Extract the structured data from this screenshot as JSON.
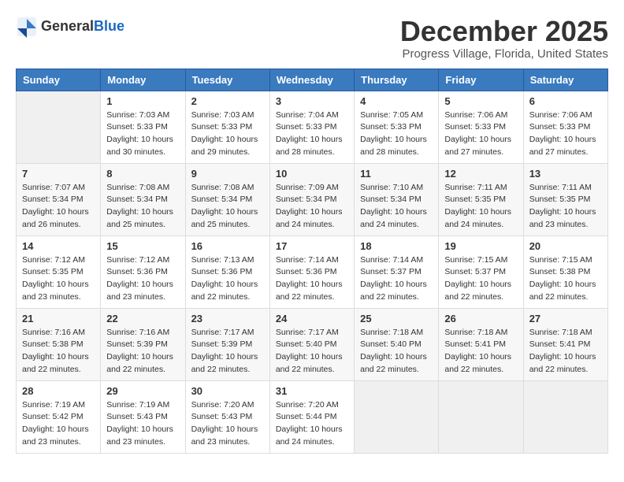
{
  "logo": {
    "general": "General",
    "blue": "Blue"
  },
  "header": {
    "month": "December 2025",
    "location": "Progress Village, Florida, United States"
  },
  "days_of_week": [
    "Sunday",
    "Monday",
    "Tuesday",
    "Wednesday",
    "Thursday",
    "Friday",
    "Saturday"
  ],
  "weeks": [
    [
      {
        "day": "",
        "info": ""
      },
      {
        "day": "1",
        "info": "Sunrise: 7:03 AM\nSunset: 5:33 PM\nDaylight: 10 hours\nand 30 minutes."
      },
      {
        "day": "2",
        "info": "Sunrise: 7:03 AM\nSunset: 5:33 PM\nDaylight: 10 hours\nand 29 minutes."
      },
      {
        "day": "3",
        "info": "Sunrise: 7:04 AM\nSunset: 5:33 PM\nDaylight: 10 hours\nand 28 minutes."
      },
      {
        "day": "4",
        "info": "Sunrise: 7:05 AM\nSunset: 5:33 PM\nDaylight: 10 hours\nand 28 minutes."
      },
      {
        "day": "5",
        "info": "Sunrise: 7:06 AM\nSunset: 5:33 PM\nDaylight: 10 hours\nand 27 minutes."
      },
      {
        "day": "6",
        "info": "Sunrise: 7:06 AM\nSunset: 5:33 PM\nDaylight: 10 hours\nand 27 minutes."
      }
    ],
    [
      {
        "day": "7",
        "info": "Sunrise: 7:07 AM\nSunset: 5:34 PM\nDaylight: 10 hours\nand 26 minutes."
      },
      {
        "day": "8",
        "info": "Sunrise: 7:08 AM\nSunset: 5:34 PM\nDaylight: 10 hours\nand 25 minutes."
      },
      {
        "day": "9",
        "info": "Sunrise: 7:08 AM\nSunset: 5:34 PM\nDaylight: 10 hours\nand 25 minutes."
      },
      {
        "day": "10",
        "info": "Sunrise: 7:09 AM\nSunset: 5:34 PM\nDaylight: 10 hours\nand 24 minutes."
      },
      {
        "day": "11",
        "info": "Sunrise: 7:10 AM\nSunset: 5:34 PM\nDaylight: 10 hours\nand 24 minutes."
      },
      {
        "day": "12",
        "info": "Sunrise: 7:11 AM\nSunset: 5:35 PM\nDaylight: 10 hours\nand 24 minutes."
      },
      {
        "day": "13",
        "info": "Sunrise: 7:11 AM\nSunset: 5:35 PM\nDaylight: 10 hours\nand 23 minutes."
      }
    ],
    [
      {
        "day": "14",
        "info": "Sunrise: 7:12 AM\nSunset: 5:35 PM\nDaylight: 10 hours\nand 23 minutes."
      },
      {
        "day": "15",
        "info": "Sunrise: 7:12 AM\nSunset: 5:36 PM\nDaylight: 10 hours\nand 23 minutes."
      },
      {
        "day": "16",
        "info": "Sunrise: 7:13 AM\nSunset: 5:36 PM\nDaylight: 10 hours\nand 22 minutes."
      },
      {
        "day": "17",
        "info": "Sunrise: 7:14 AM\nSunset: 5:36 PM\nDaylight: 10 hours\nand 22 minutes."
      },
      {
        "day": "18",
        "info": "Sunrise: 7:14 AM\nSunset: 5:37 PM\nDaylight: 10 hours\nand 22 minutes."
      },
      {
        "day": "19",
        "info": "Sunrise: 7:15 AM\nSunset: 5:37 PM\nDaylight: 10 hours\nand 22 minutes."
      },
      {
        "day": "20",
        "info": "Sunrise: 7:15 AM\nSunset: 5:38 PM\nDaylight: 10 hours\nand 22 minutes."
      }
    ],
    [
      {
        "day": "21",
        "info": "Sunrise: 7:16 AM\nSunset: 5:38 PM\nDaylight: 10 hours\nand 22 minutes."
      },
      {
        "day": "22",
        "info": "Sunrise: 7:16 AM\nSunset: 5:39 PM\nDaylight: 10 hours\nand 22 minutes."
      },
      {
        "day": "23",
        "info": "Sunrise: 7:17 AM\nSunset: 5:39 PM\nDaylight: 10 hours\nand 22 minutes."
      },
      {
        "day": "24",
        "info": "Sunrise: 7:17 AM\nSunset: 5:40 PM\nDaylight: 10 hours\nand 22 minutes."
      },
      {
        "day": "25",
        "info": "Sunrise: 7:18 AM\nSunset: 5:40 PM\nDaylight: 10 hours\nand 22 minutes."
      },
      {
        "day": "26",
        "info": "Sunrise: 7:18 AM\nSunset: 5:41 PM\nDaylight: 10 hours\nand 22 minutes."
      },
      {
        "day": "27",
        "info": "Sunrise: 7:18 AM\nSunset: 5:41 PM\nDaylight: 10 hours\nand 22 minutes."
      }
    ],
    [
      {
        "day": "28",
        "info": "Sunrise: 7:19 AM\nSunset: 5:42 PM\nDaylight: 10 hours\nand 23 minutes."
      },
      {
        "day": "29",
        "info": "Sunrise: 7:19 AM\nSunset: 5:43 PM\nDaylight: 10 hours\nand 23 minutes."
      },
      {
        "day": "30",
        "info": "Sunrise: 7:20 AM\nSunset: 5:43 PM\nDaylight: 10 hours\nand 23 minutes."
      },
      {
        "day": "31",
        "info": "Sunrise: 7:20 AM\nSunset: 5:44 PM\nDaylight: 10 hours\nand 24 minutes."
      },
      {
        "day": "",
        "info": ""
      },
      {
        "day": "",
        "info": ""
      },
      {
        "day": "",
        "info": ""
      }
    ]
  ]
}
